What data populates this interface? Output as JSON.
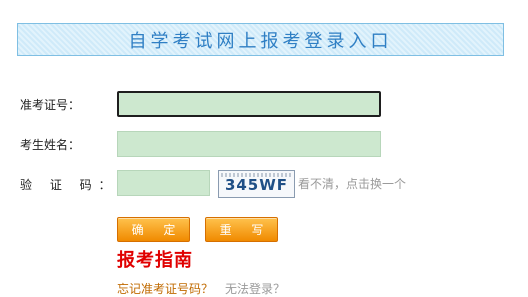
{
  "banner": {
    "title": "自学考试网上报考登录入口"
  },
  "form": {
    "exam_number_label": "准考证号：",
    "name_label": "考生姓名：",
    "captcha_label": "验 证 码：",
    "exam_number_value": "",
    "name_value": "",
    "captcha_value": "",
    "captcha_image_text": "345WF",
    "refresh_text": "看不清，点击换一个"
  },
  "buttons": {
    "confirm_label": "确 定",
    "reset_label": "重 写"
  },
  "guide_text": "报考指南",
  "links": {
    "forgot_number": "忘记准考证号码？",
    "cannot_login": "无法登录？"
  },
  "colors": {
    "banner_text": "#2f7fc4",
    "input_bg": "#cde8cf",
    "button_orange": "#f08a00",
    "guide_red": "#e00000"
  }
}
